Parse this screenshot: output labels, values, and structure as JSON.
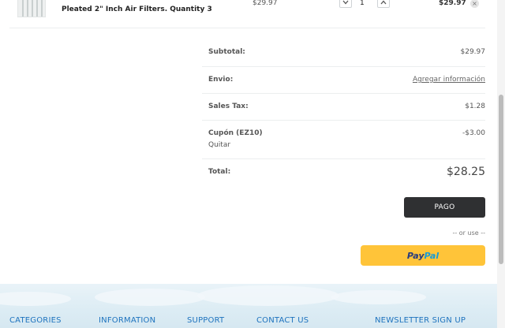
{
  "product": {
    "name_line1": "…",
    "name_line2": "Pleated 2\" Inch Air Filters. Quantity 3",
    "price": "$29.97",
    "quantity": "1",
    "line_total": "$29.97",
    "remove_glyph": "×",
    "decrease_icon": "chevron-down-icon",
    "increase_icon": "chevron-up-icon"
  },
  "totals": {
    "subtotal_label": "Subtotal:",
    "subtotal_value": "$29.97",
    "shipping_label": "Envio:",
    "shipping_link": "Agregar información",
    "tax_label": "Sales Tax:",
    "tax_value": "$1.28",
    "coupon_label": "Cupón (EZ10)",
    "coupon_remove": "Quitar",
    "coupon_value": "-$3.00",
    "total_label": "Total:",
    "total_value": "$28.25"
  },
  "checkout": {
    "pago_label": "PAGO",
    "or_use": "-- or use --",
    "paypal_part1": "Pay",
    "paypal_part2": "Pal"
  },
  "footer": {
    "headings": [
      "CATEGORIES",
      "INFORMATION",
      "SUPPORT",
      "CONTACT US",
      "NEWSLETTER SIGN UP"
    ]
  },
  "colors": {
    "accent": "#1e73be",
    "checkout_button": "#2f3032",
    "paypal_yellow": "#ffc439",
    "paypal_navy": "#253b80",
    "paypal_blue": "#179bd7"
  }
}
